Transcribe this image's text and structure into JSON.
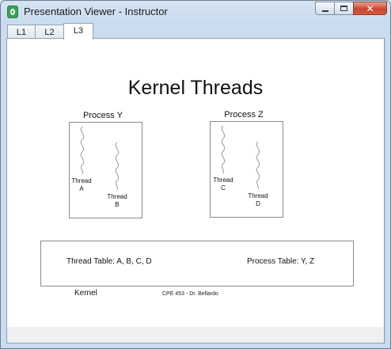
{
  "window": {
    "title": "Presentation Viewer - Instructor",
    "close_glyph": "✕"
  },
  "tabs": [
    {
      "label": "L1"
    },
    {
      "label": "L2"
    },
    {
      "label": "L3",
      "selected": true
    }
  ],
  "slide": {
    "title": "Kernel Threads",
    "processes": [
      {
        "label": "Process Y",
        "threads": [
          {
            "line1": "Thread",
            "line2": "A"
          },
          {
            "line1": "Thread",
            "line2": "B"
          }
        ]
      },
      {
        "label": "Process Z",
        "threads": [
          {
            "line1": "Thread",
            "line2": "C"
          },
          {
            "line1": "Thread",
            "line2": "D"
          }
        ]
      }
    ],
    "thread_table": "Thread Table: A, B, C, D",
    "process_table": "Process Table: Y, Z",
    "kernel_label": "Kernel",
    "footer": "CPE 453 - Dr. Bellardo"
  },
  "colors": {
    "accent": "#3aa35a",
    "close_button": "#c9472f"
  }
}
